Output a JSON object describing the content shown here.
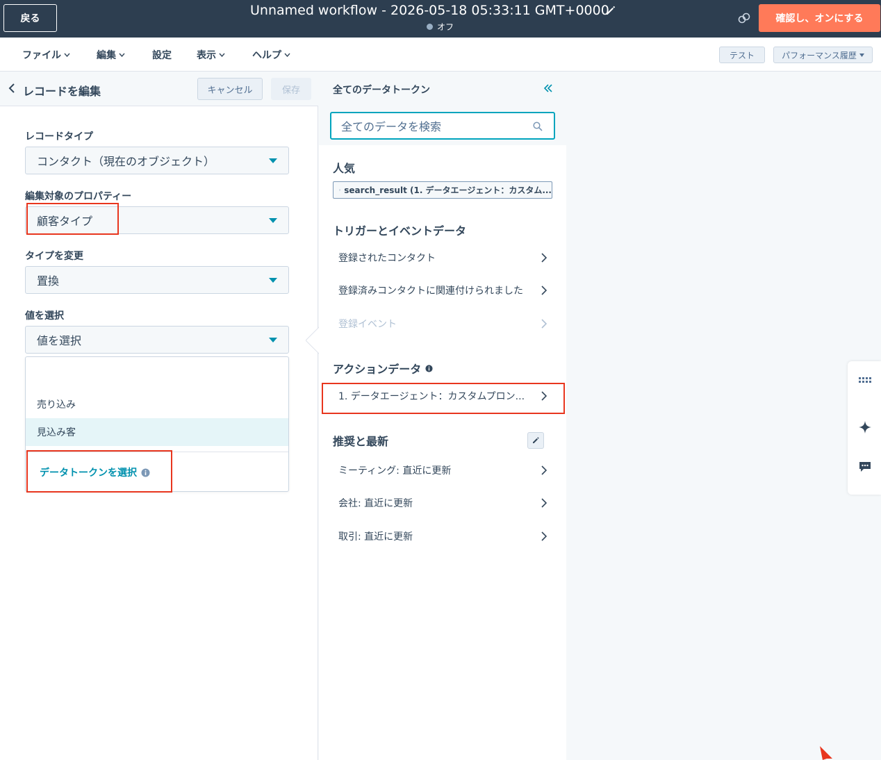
{
  "topbar": {
    "back_label": "戻る",
    "title": "Unnamed workflow - 2026-05-18 05:33:11 GMT+0000",
    "status": "オフ",
    "confirm_label": "確認し、オンにする"
  },
  "menubar": {
    "items": [
      "ファイル",
      "編集",
      "設定",
      "表示",
      "ヘルプ"
    ],
    "test_label": "テスト",
    "performance_label": "パフォーマンス履歴"
  },
  "left_panel": {
    "title": "レコードを編集",
    "cancel_label": "キャンセル",
    "save_label": "保存",
    "record_type": {
      "label": "レコードタイプ",
      "value": "コンタクト（現在のオブジェクト）"
    },
    "property": {
      "label": "編集対象のプロパティー",
      "value": "顧客タイプ"
    },
    "change_type": {
      "label": "タイプを変更",
      "value": "置換"
    },
    "select_value": {
      "label": "値を選択",
      "value": "値を選択"
    },
    "dropdown": {
      "options": [
        "売り込み",
        "見込み客"
      ],
      "token_label": "データトークンを選択"
    }
  },
  "mid_panel": {
    "title": "全てのデータトークン",
    "search_placeholder": "全てのデータを検索",
    "popular": {
      "heading": "人気",
      "chip": "search_result (1. データエージェント：カスタム..."
    },
    "trigger": {
      "heading": "トリガーとイベントデータ",
      "rows": [
        "登録されたコンタクト",
        "登録済みコンタクトに関連付けられました",
        "登録イベント"
      ]
    },
    "action": {
      "heading": "アクションデータ",
      "rows": [
        "1. データエージェント：カスタムプロン..."
      ]
    },
    "recommended": {
      "heading": "推奨と最新",
      "rows": [
        "ミーティング: 直近に更新",
        "会社: 直近に更新",
        "取引: 直近に更新"
      ]
    }
  },
  "colors": {
    "header_bg": "#2d3e50",
    "accent_orange": "#ff7a59",
    "teal": "#0091ae",
    "highlight_red": "#e8361e"
  }
}
